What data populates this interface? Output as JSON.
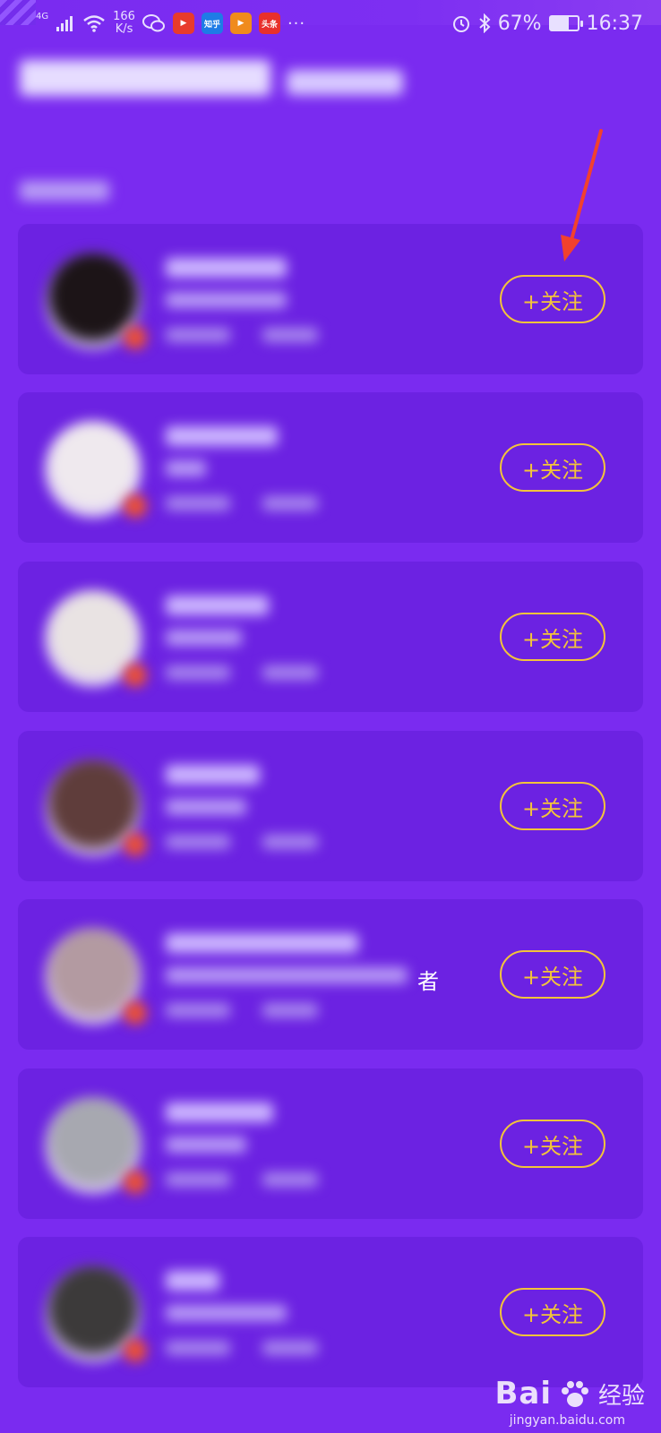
{
  "status_bar": {
    "network": "4G",
    "speed_value": "166",
    "speed_unit": "K/s",
    "notification_icons": [
      {
        "name": "video-app-icon",
        "color": "#e83b2c"
      },
      {
        "name": "zhihu-app-icon",
        "text": "知乎",
        "color": "#1e7be6"
      },
      {
        "name": "play-app-icon",
        "color": "#f08b1c"
      },
      {
        "name": "toutiao-app-icon",
        "text": "头条",
        "color": "#e8302c"
      }
    ],
    "more": "···",
    "battery_percent": "67%",
    "battery_level": 0.67,
    "time": "16:37"
  },
  "cards": [
    {
      "follow_label": "+关注",
      "avatar_color": "#1c1417"
    },
    {
      "follow_label": "+关注",
      "avatar_color": "#efe9ee"
    },
    {
      "follow_label": "+关注",
      "avatar_color": "#e9e3e3"
    },
    {
      "follow_label": "+关注",
      "avatar_color": "#5f3d3b"
    },
    {
      "follow_label": "+关注",
      "avatar_color": "#b39aa1"
    },
    {
      "follow_label": "+关注",
      "avatar_color": "#a7a8b0"
    },
    {
      "follow_label": "+关注",
      "avatar_color": "#3c3a3a"
    }
  ],
  "stray_text": "者",
  "watermark": {
    "logo": "Bai",
    "logo_suffix": "经验",
    "url": "jingyan.baidu.com"
  },
  "colors": {
    "background": "#7a2bf0",
    "card": "#6c22e2",
    "follow_accent": "#f3c43a",
    "annotation_arrow": "#f2412d"
  }
}
